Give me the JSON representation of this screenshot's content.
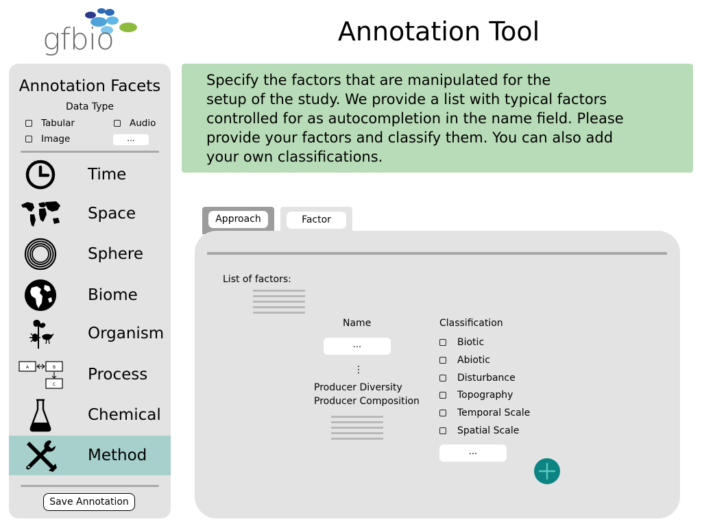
{
  "logo": {
    "text": "gfbio"
  },
  "app_title": "Annotation Tool",
  "sidebar": {
    "title": "Annotation Facets",
    "data_type": {
      "label": "Data Type",
      "options": [
        "Tabular",
        "Audio",
        "Image"
      ],
      "more": "..."
    },
    "facets": [
      {
        "label": "Time",
        "icon": "clock-icon"
      },
      {
        "label": "Space",
        "icon": "world-map-icon"
      },
      {
        "label": "Sphere",
        "icon": "concentric-circles-icon"
      },
      {
        "label": "Biome",
        "icon": "globe-icon"
      },
      {
        "label": "Organism",
        "icon": "organisms-icon"
      },
      {
        "label": "Process",
        "icon": "process-diagram-icon"
      },
      {
        "label": "Chemical",
        "icon": "flask-icon"
      },
      {
        "label": "Method",
        "icon": "tools-icon"
      }
    ],
    "active_facet": "Method",
    "active_color": "#a7cfcc",
    "save_label": "Save Annotation",
    "process_icon_labels": [
      "A",
      "B",
      "C"
    ]
  },
  "info_text": "Specify the factors that are manipulated for the\nsetup of the study. We provide a list with typical factors\ncontrolled for as autocompletion in the name field. Please\nprovide your factors and classify them. You can also add\nyour own classifications.",
  "info_color": "#b8dcb8",
  "tabs": [
    {
      "label": "Approach",
      "selected": true
    },
    {
      "label": "Factor",
      "selected": false
    }
  ],
  "panel": {
    "list_label": "List of factors:",
    "name_label": "Name",
    "name_value": "...",
    "more_indicator": "⋮",
    "suggestions": [
      "Producer Diversity",
      "Producer Composition"
    ],
    "classification_label": "Classification",
    "classifications": [
      "Biotic",
      "Abiotic",
      "Disturbance",
      "Topography",
      "Temporal Scale",
      "Spatial Scale"
    ],
    "classification_more": "...",
    "add_button_color": "#0c8484",
    "add_icon": "plus-icon"
  }
}
